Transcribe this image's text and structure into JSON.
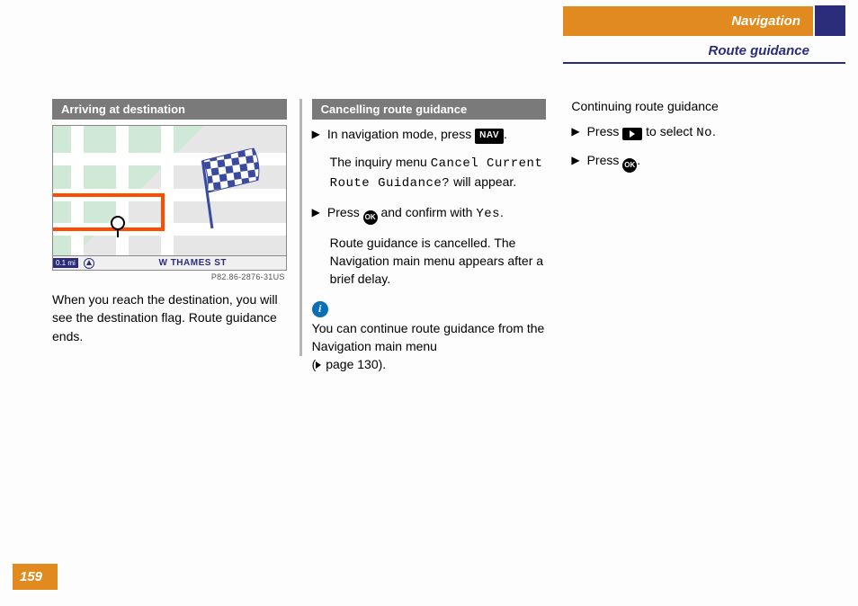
{
  "header": {
    "section": "Navigation",
    "subsection": "Route guidance"
  },
  "page_number": "159",
  "col1": {
    "heading": "Arriving at destination",
    "map": {
      "scale": "0.1 mi",
      "street": "W THAMES ST",
      "figure_code": "P82.86-2876-31US"
    },
    "para": "When you reach the destination, you will see the destination flag. Route guidance ends."
  },
  "col2": {
    "heading": "Cancelling route guidance",
    "step1_a": "In navigation mode, press ",
    "step1_b": ".",
    "nav_key": "NAV",
    "para1_a": "The inquiry menu ",
    "para1_mono": "Cancel Current Route Guidance?",
    "para1_b": " will appear.",
    "step2_a": "Press ",
    "step2_b": " and confirm with ",
    "step2_mono": "Yes",
    "step2_c": ".",
    "ok_key": "OK",
    "para2": "Route guidance is cancelled. The Navigation main menu appears after a brief delay.",
    "info_a": "You can continue route guidance from the Navigation main menu",
    "info_b": "page 130)."
  },
  "col3": {
    "subheading": "Continuing route guidance",
    "step1_a": "Press ",
    "step1_b": " to select ",
    "step1_mono": "No",
    "step1_c": ".",
    "step2_a": "Press ",
    "step2_b": ".",
    "ok_key": "OK"
  }
}
